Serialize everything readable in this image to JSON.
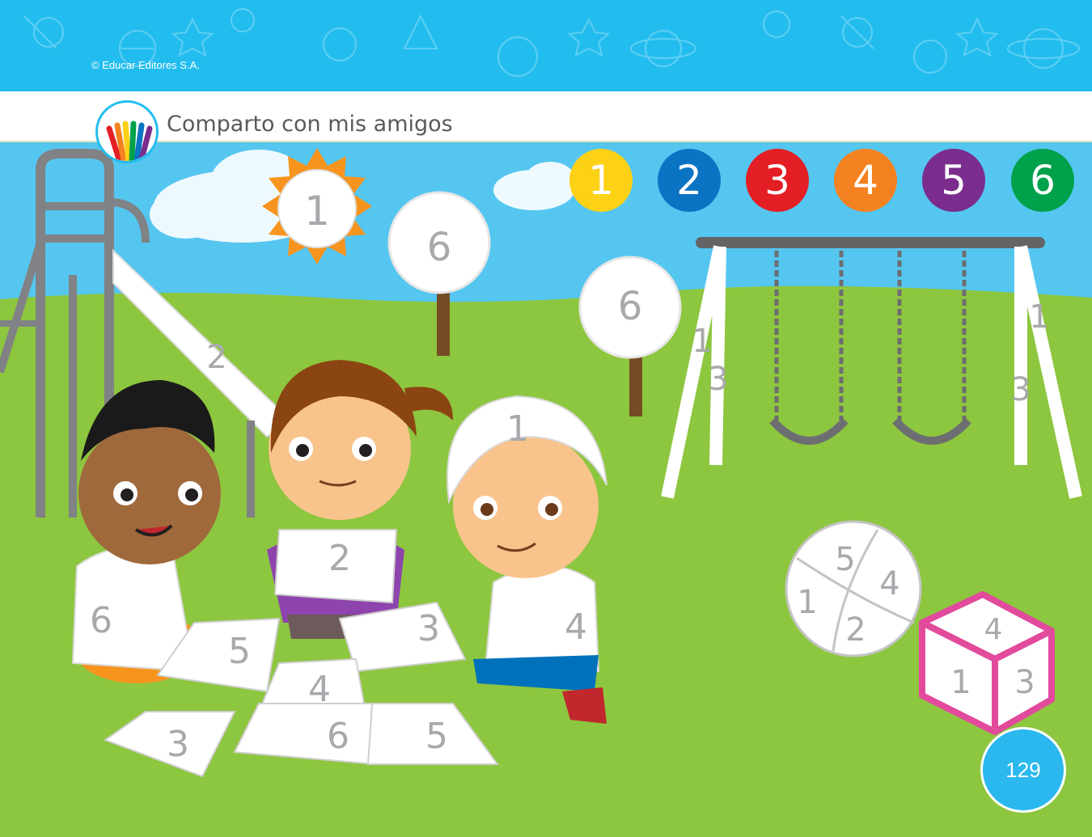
{
  "header": {
    "copyright": "© Educar Editores S.A.",
    "title": "Comparto con mis amigos",
    "badge_icon": "colored-pencils-icon"
  },
  "color_legend": [
    {
      "number": "1",
      "color": "#fcd116"
    },
    {
      "number": "2",
      "color": "#0a74c3"
    },
    {
      "number": "3",
      "color": "#e31e24"
    },
    {
      "number": "4",
      "color": "#f58220"
    },
    {
      "number": "5",
      "color": "#7b2d8e"
    },
    {
      "number": "6",
      "color": "#00a14b"
    }
  ],
  "scene_numbers": {
    "sun": "1",
    "tree_left": "6",
    "tree_right": "6",
    "slide": "2",
    "swing_left_upper": "1",
    "swing_left_lower": "3",
    "swing_right_upper": "1",
    "swing_right_lower": "3",
    "girl_puzzle": "2",
    "boy_left_shirt": "6",
    "boy_right_hair": "1",
    "boy_right_shirt": "4",
    "puzzle_a": "5",
    "puzzle_b": "3",
    "puzzle_c": "4",
    "puzzle_d": "3",
    "puzzle_e": "6",
    "puzzle_f": "5",
    "ball_top": "5",
    "ball_right": "4",
    "ball_left": "1",
    "ball_bottom": "2",
    "cube_top": "4",
    "cube_front": "1",
    "cube_side": "3"
  },
  "footer": {
    "page_number": "129"
  }
}
